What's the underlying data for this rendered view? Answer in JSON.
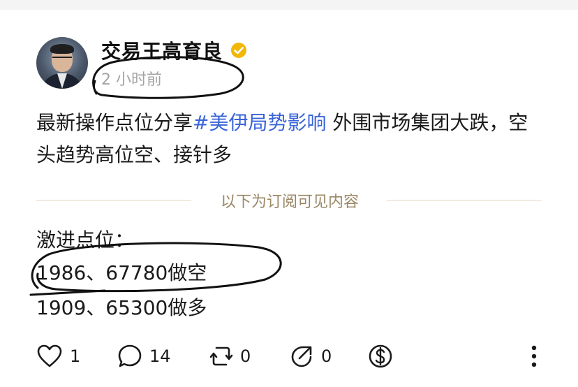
{
  "post": {
    "author": "交易王高育良",
    "time": "2 小时前",
    "text_main": "最新操作点位分享",
    "hashtag": "#美伊局势影响",
    "text_rest": " 外围市场集团大跌，空头趋势高位空、接针多"
  },
  "subscription_divider": "以下为订阅可见内容",
  "content_lines": [
    "激进点位：",
    "1986、67780做空",
    "1909、65300做多"
  ],
  "actions": {
    "likes": "1",
    "comments": "14",
    "reposts": "0",
    "shares": "0"
  },
  "icons": [
    "verified-badge-icon",
    "heart-icon",
    "comment-icon",
    "repost-icon",
    "share-icon",
    "dollar-icon",
    "more-vertical-icon"
  ],
  "colors": {
    "hashtag": "#3a64d8",
    "verified": "#f2b705",
    "annotation": "#111111",
    "divider_text": "#9a8766"
  }
}
